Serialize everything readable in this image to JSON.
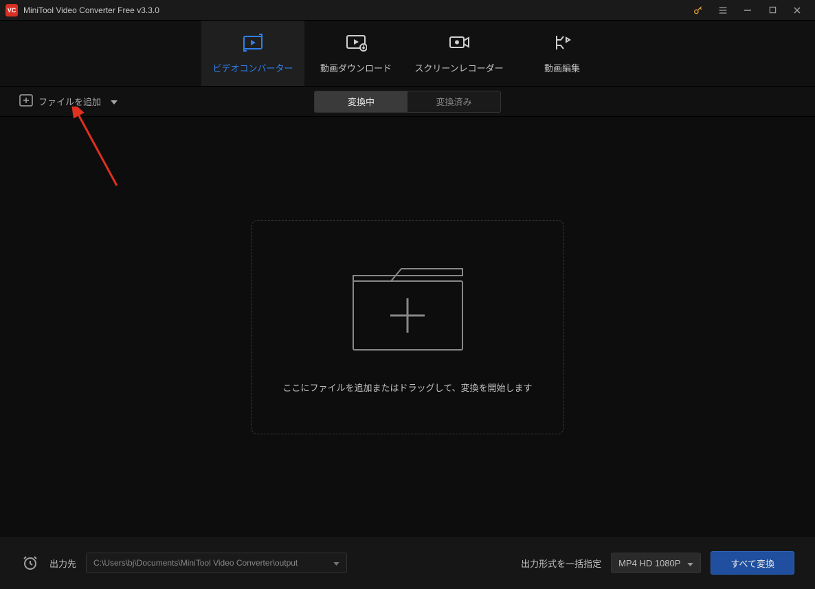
{
  "titlebar": {
    "title": "MiniTool Video Converter Free v3.3.0"
  },
  "nav": {
    "tabs": [
      {
        "label": "ビデオコンバーター",
        "icon": "convert-icon",
        "active": true
      },
      {
        "label": "動画ダウンロード",
        "icon": "download-icon",
        "active": false
      },
      {
        "label": "スクリーンレコーダー",
        "icon": "record-icon",
        "active": false
      },
      {
        "label": "動画編集",
        "icon": "edit-icon",
        "active": false
      }
    ]
  },
  "toolbar": {
    "add_file_label": "ファイルを追加",
    "segments": [
      {
        "label": "変換中",
        "active": true
      },
      {
        "label": "変換済み",
        "active": false
      }
    ]
  },
  "dropzone": {
    "text": "ここにファイルを追加またはドラッグして、変換を開始します"
  },
  "bottom": {
    "output_label": "出力先",
    "output_path": "C:\\Users\\bj\\Documents\\MiniTool Video Converter\\output",
    "format_label": "出力形式を一括指定",
    "format_value": "MP4 HD 1080P",
    "convert_button": "すべて変換"
  }
}
